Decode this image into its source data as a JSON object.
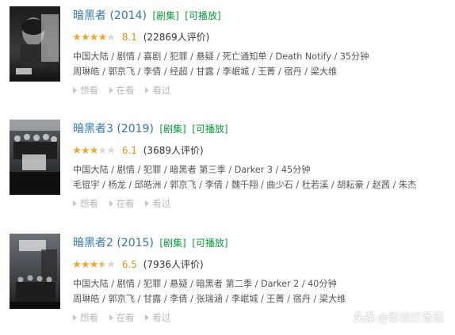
{
  "items": [
    {
      "title": "暗黑者 (2014)",
      "tags": [
        "[剧集]",
        "[可播放]"
      ],
      "score": "8.1",
      "rating_fraction": 0.8,
      "votes": "(22869人评价)",
      "meta_line1": "中国大陆 / 剧情 / 喜剧 / 犯罪 / 悬疑 / 死亡通知单 / Death Notify / 35分钟",
      "meta_line2": "周琳皓 / 郭京飞 / 李倩 / 经超 / 甘露 / 李岷城 / 王菁 / 宿丹 / 梁大维",
      "actions": [
        "想看",
        "在看",
        "看过"
      ],
      "poster_icon": "poster-image-2014"
    },
    {
      "title": "暗黑者3 (2019)",
      "tags": [
        "[剧集]",
        "[可播放]"
      ],
      "score": "6.1",
      "rating_fraction": 0.6,
      "votes": "(3689人评价)",
      "meta_line1": "中国大陆 / 剧情 / 犯罪 / 暗黑者 第三季 / Darker 3 / 45分钟",
      "meta_line2": "毛锟宇 / 杨龙 / 邱皓洲 / 郭京飞 / 李倩 / 魏千翔 / 曲少石 / 杜若溪 / 胡耘豪 / 赵茜 / 朱杰",
      "actions": [
        "想看",
        "在看",
        "看过"
      ],
      "poster_icon": "poster-image-2019"
    },
    {
      "title": "暗黑者2 (2015)",
      "tags": [
        "[剧集]",
        "[可播放]"
      ],
      "score": "6.5",
      "rating_fraction": 0.7,
      "votes": "(7936人评价)",
      "meta_line1": "中国大陆 / 剧情 / 犯罪 / 悬疑 / 暗黑者 第二季 / Darker 2 / 40分钟",
      "meta_line2": "周琳皓 / 郭京飞 / 甘露 / 李倩 / 张瑞涵 / 李岷城 / 王菁 / 宿丹 / 梁大维",
      "actions": [
        "想看",
        "在看",
        "看过"
      ],
      "poster_icon": "poster-image-2015"
    }
  ],
  "watermark": {
    "logo": "头条",
    "at": "@",
    "account": "影视烂番茄"
  },
  "colors": {
    "title": "#3377aa",
    "tag": "#0a9c3a",
    "score": "#e09015",
    "star_filled": "#f5a623",
    "star_empty": "#d8d8d8",
    "meta": "#555555",
    "action": "#b9b9b9"
  }
}
